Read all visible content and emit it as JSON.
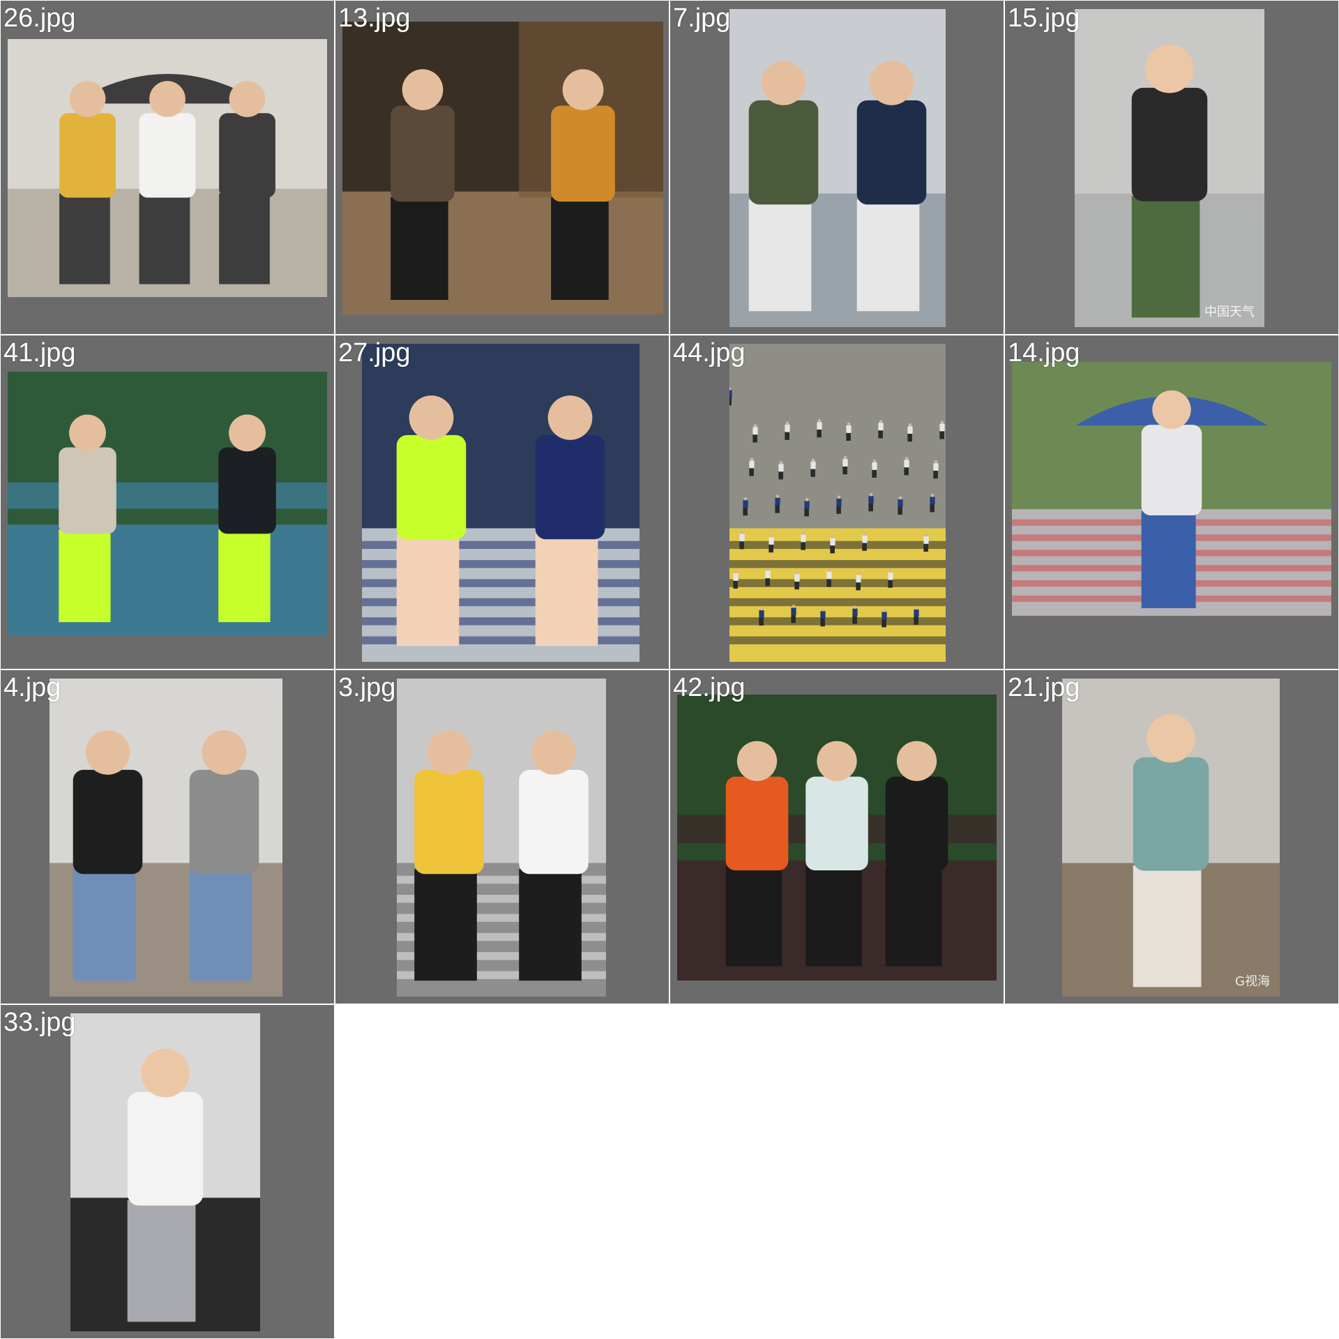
{
  "gallery": {
    "thumbnails": [
      {
        "filename": "26.jpg",
        "scene": "umbrella-group",
        "palette": [
          "#d9d6cf",
          "#b8b2a6",
          "#e2b33c",
          "#f2f2f0",
          "#3d3d3d"
        ],
        "watermark": ""
      },
      {
        "filename": "13.jpg",
        "scene": "night-street",
        "palette": [
          "#3a2f25",
          "#8a6f52",
          "#5b4a3a",
          "#d18a2a",
          "#1c1c1c"
        ],
        "watermark": ""
      },
      {
        "filename": "7.jpg",
        "scene": "travelers-luggage",
        "palette": [
          "#c9cdd2",
          "#9aa2aa",
          "#4a5a3a",
          "#1f2d4a",
          "#e7e7e7"
        ],
        "watermark": ""
      },
      {
        "filename": "15.jpg",
        "scene": "woman-walking-phone",
        "palette": [
          "#c8c8c6",
          "#b1b3b3",
          "#2a2a2a",
          "#f3f3f3",
          "#4d6b3f"
        ],
        "watermark": "中国天气"
      },
      {
        "filename": "41.jpg",
        "scene": "traffic-guards",
        "palette": [
          "#2f5a3a",
          "#3d7a92",
          "#cfc7b5",
          "#1c1f24",
          "#c6ff2a"
        ],
        "watermark": ""
      },
      {
        "filename": "27.jpg",
        "scene": "traffic-police",
        "palette": [
          "#2c3c5a",
          "#b8c0c7",
          "#c6ff2a",
          "#1f2e6b",
          "#f3d1b6"
        ],
        "watermark": ""
      },
      {
        "filename": "44.jpg",
        "scene": "crowd-crossing",
        "palette": [
          "#8e8e86",
          "#e3c94a",
          "#5d5d5a",
          "#2a2a2a",
          "#1f3c7a"
        ],
        "watermark": ""
      },
      {
        "filename": "14.jpg",
        "scene": "man-umbrella-crossing",
        "palette": [
          "#6d8a55",
          "#b7b3b6",
          "#e7e7e9",
          "#d34b4b",
          "#3b5fa8"
        ],
        "watermark": ""
      },
      {
        "filename": "4.jpg",
        "scene": "couple-walking",
        "palette": [
          "#d8d6d3",
          "#9b8f84",
          "#1e1e1e",
          "#8c8c8c",
          "#6f8fb8"
        ],
        "watermark": ""
      },
      {
        "filename": "3.jpg",
        "scene": "couple-holding-hands",
        "palette": [
          "#c8c8c8",
          "#8e8e8e",
          "#f0c43a",
          "#f4f4f4",
          "#1d1d1d"
        ],
        "watermark": ""
      },
      {
        "filename": "42.jpg",
        "scene": "runners-path",
        "palette": [
          "#2a4a2a",
          "#3b2a2a",
          "#e65a1f",
          "#d9e6e6",
          "#1b1b1b"
        ],
        "watermark": ""
      },
      {
        "filename": "21.jpg",
        "scene": "woman-backpack-wind",
        "palette": [
          "#c7c4bf",
          "#8a7a68",
          "#7aa6a3",
          "#4f6f9a",
          "#e6e0d8"
        ],
        "watermark": "G视海"
      },
      {
        "filename": "33.jpg",
        "scene": "woman-suspender-skirt",
        "palette": [
          "#d8d8d8",
          "#2a2a2a",
          "#f3f3f3",
          "#6a8a5a",
          "#a8aab0"
        ],
        "watermark": ""
      }
    ]
  }
}
